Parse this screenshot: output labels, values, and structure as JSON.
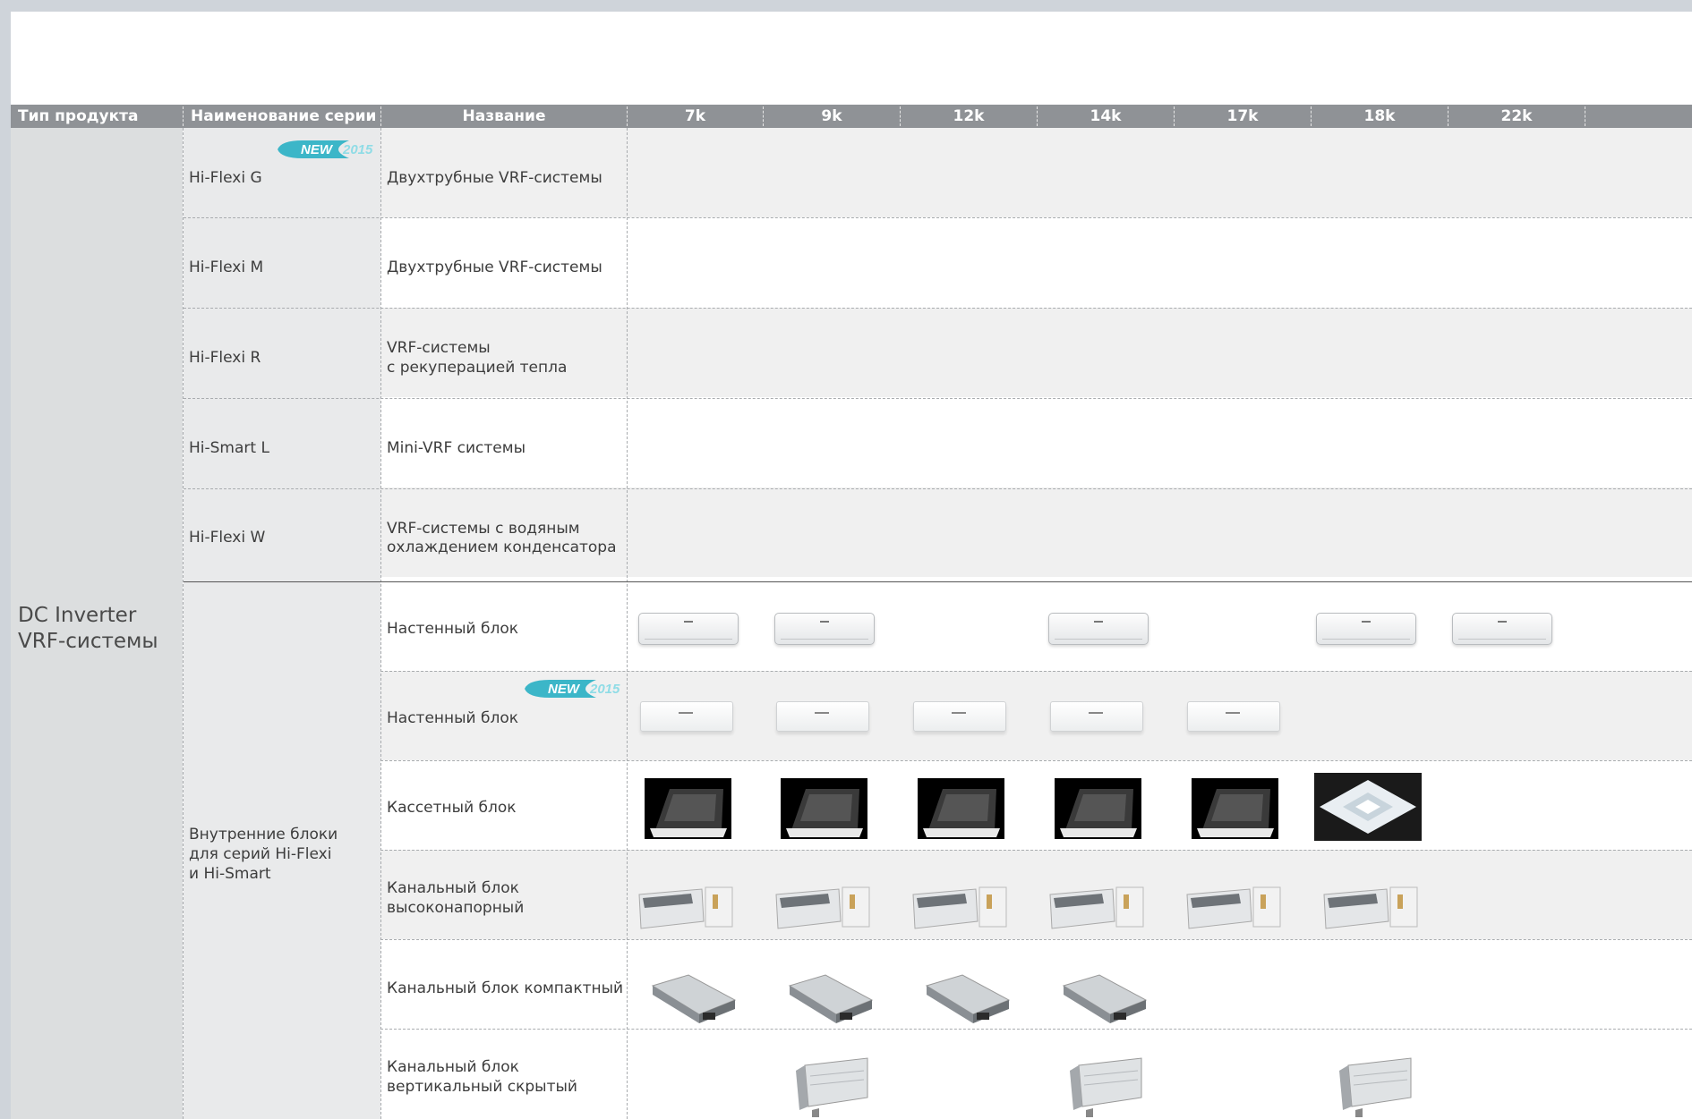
{
  "header": {
    "product_type": "Тип продукта",
    "series_name": "Наименование серии",
    "name": "Название",
    "capacities": [
      "7k",
      "9k",
      "12k",
      "14k",
      "17k",
      "18k",
      "22k",
      ""
    ]
  },
  "product_type": {
    "line1": "DC Inverter",
    "line2": "VRF-системы"
  },
  "badges": {
    "new": "NEW",
    "year": "2015"
  },
  "outdoor_rows": [
    {
      "series": "Hi-Flexi G",
      "name_l1": "Двухтрубные VRF-системы",
      "name_l2": ""
    },
    {
      "series": "Hi-Flexi M",
      "name_l1": "Двухтрубные VRF-системы",
      "name_l2": ""
    },
    {
      "series": "Hi-Flexi R",
      "name_l1": "VRF-системы",
      "name_l2": "с рекуперацией тепла"
    },
    {
      "series": "Hi-Smart L",
      "name_l1": "Mini-VRF системы",
      "name_l2": ""
    },
    {
      "series": "Hi-Flexi W",
      "name_l1": "VRF-системы с водяным",
      "name_l2": "охлаждением конденсатора"
    }
  ],
  "indoor_series": {
    "l1": "Внутренние блоки",
    "l2": "для серий Hi-Flexi",
    "l3": "и Hi-Smart"
  },
  "indoor_rows": [
    {
      "name_l1": "Настенный блок",
      "name_l2": "",
      "icon": "wall-unit-icon",
      "available": [
        "7k",
        "9k",
        "14k",
        "18k",
        "22k"
      ]
    },
    {
      "name_l1": "Настенный блок",
      "name_l2": "",
      "icon": "wall-unit-new-icon",
      "available": [
        "7k",
        "9k",
        "12k",
        "14k",
        "17k"
      ]
    },
    {
      "name_l1": "Кассетный блок",
      "name_l2": "",
      "icon": "cassette-unit-icon",
      "available": [
        "7k",
        "9k",
        "12k",
        "14k",
        "17k",
        "18k"
      ]
    },
    {
      "name_l1": "Канальный блок",
      "name_l2": "высоконапорный",
      "icon": "high-pressure-duct-icon",
      "available": [
        "7k",
        "9k",
        "12k",
        "14k",
        "17k",
        "18k"
      ]
    },
    {
      "name_l1": "Канальный блок компактный",
      "name_l2": "",
      "icon": "compact-duct-icon",
      "available": [
        "7k",
        "9k",
        "12k",
        "14k"
      ]
    },
    {
      "name_l1": "Канальный блок",
      "name_l2": "вертикальный скрытый",
      "icon": "vertical-concealed-duct-icon",
      "available": [
        "9k",
        "14k",
        "18k"
      ]
    }
  ],
  "colors": {
    "header_bg": "#8f9296",
    "grey_col": "#e8e9ea",
    "row_shade": "#f0f0f0",
    "badge": "#3cb6c8"
  }
}
